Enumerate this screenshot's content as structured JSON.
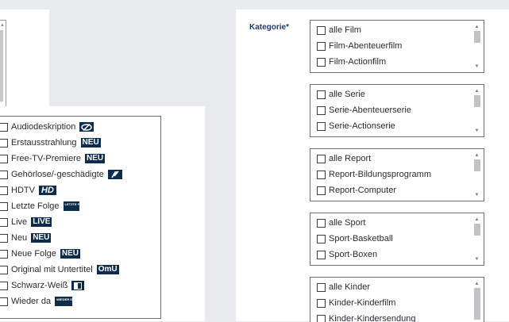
{
  "features": {
    "items": [
      {
        "label": "Audiodeskription",
        "badge": "",
        "icon": "audio-description-icon"
      },
      {
        "label": "Erstausstrahlung",
        "badge": "NEU"
      },
      {
        "label": "Free-TV-Premiere",
        "badge": "NEU"
      },
      {
        "label": "Gehörlose/-geschädigte",
        "badge": "",
        "icon": "sign-language-icon"
      },
      {
        "label": "HDTV",
        "badge": "HD"
      },
      {
        "label": "Letzte Folge",
        "badge": "LETZTE FOLGE"
      },
      {
        "label": "Live",
        "badge": "LIVE"
      },
      {
        "label": "Neu",
        "badge": "NEU"
      },
      {
        "label": "Neue Folge",
        "badge": "NEU"
      },
      {
        "label": "Original mit Untertitel",
        "badge": "OmU"
      },
      {
        "label": "Schwarz-Weiß",
        "badge": "",
        "icon": "black-white-icon"
      },
      {
        "label": "Wieder da",
        "badge": "WIEDER DA"
      }
    ]
  },
  "kategorie": {
    "label": "Kategorie*",
    "groups": [
      {
        "items": [
          "alle Film",
          "Film-Abenteuerfilm",
          "Film-Actionfilm"
        ]
      },
      {
        "items": [
          "alle Serie",
          "Serie-Abenteuerserie",
          "Serie-Actionserie"
        ]
      },
      {
        "items": [
          "alle Report",
          "Report-Bildungsprogramm",
          "Report-Computer"
        ]
      },
      {
        "items": [
          "alle Sport",
          "Sport-Basketball",
          "Sport-Boxen"
        ]
      },
      {
        "items": [
          "alle Kinder",
          "Kinder-Kinderfilm",
          "Kinder-Kindersendung"
        ]
      }
    ]
  },
  "colors": {
    "badge": "#0d2b4b",
    "label": "#1f3a63",
    "background": "#e9eaee"
  }
}
